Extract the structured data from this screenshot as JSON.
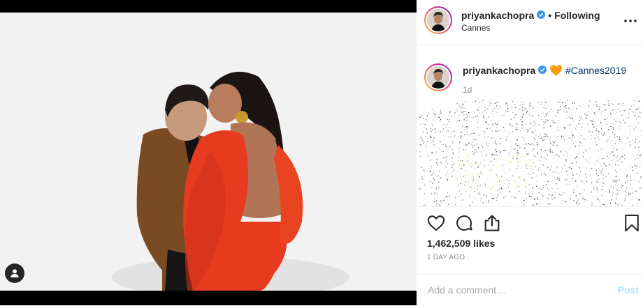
{
  "post": {
    "username": "priyankachopra",
    "follow_label": "Following",
    "separator": "•",
    "location": "Cannes",
    "verified_icon": "verified-badge-icon",
    "accent_blue": "#3897f0"
  },
  "caption": {
    "username": "priyankachopra",
    "emoji": "🧡",
    "hashtag": "#Cannes2019",
    "time_ago": "1d"
  },
  "engagement": {
    "likes": "1,462,509 likes",
    "date": "1 DAY AGO"
  },
  "comment": {
    "placeholder": "Add a comment…",
    "post_label": "Post"
  },
  "icons": {
    "like": "heart-icon",
    "comment": "comment-bubble-icon",
    "share": "share-icon",
    "save": "bookmark-icon",
    "more": "more-options-icon",
    "user_tags": "person-icon"
  }
}
